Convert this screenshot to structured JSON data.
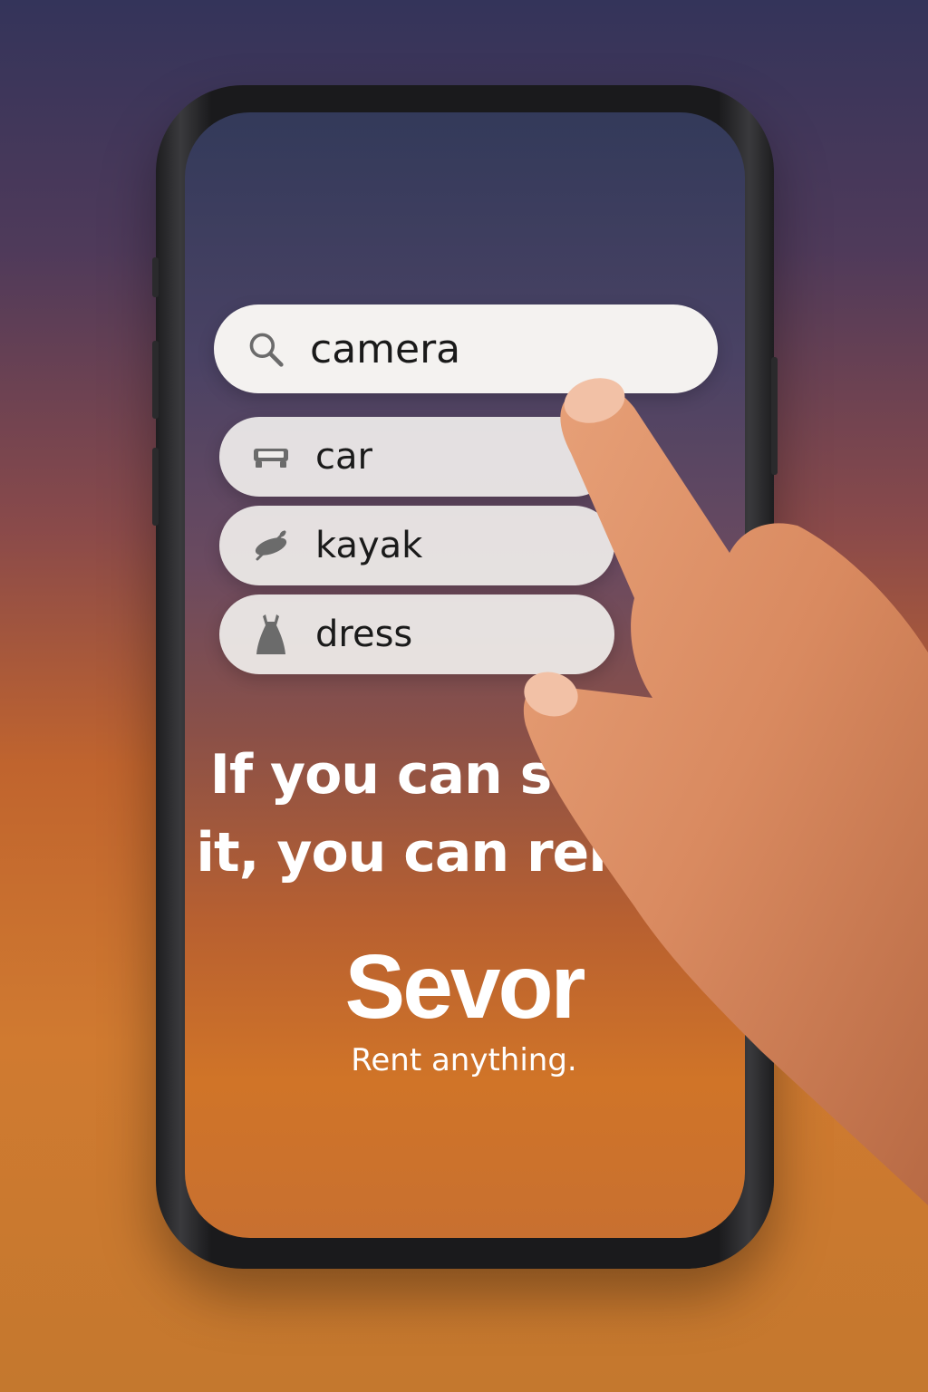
{
  "search": {
    "query": "camera",
    "icon": "search-icon"
  },
  "suggestions": [
    {
      "label": "car",
      "icon": "car-icon"
    },
    {
      "label": "kayak",
      "icon": "kayak-icon"
    },
    {
      "label": "dress",
      "icon": "dress-icon"
    }
  ],
  "headline": {
    "line1": "If you can search",
    "line2": "it, you can rent it."
  },
  "brand": {
    "name": "Sevor",
    "tagline": "Rent anything."
  },
  "colors": {
    "pill_bg": "#f4f2f0",
    "icon_gray": "#6b6b6b",
    "text_white": "#ffffff"
  }
}
